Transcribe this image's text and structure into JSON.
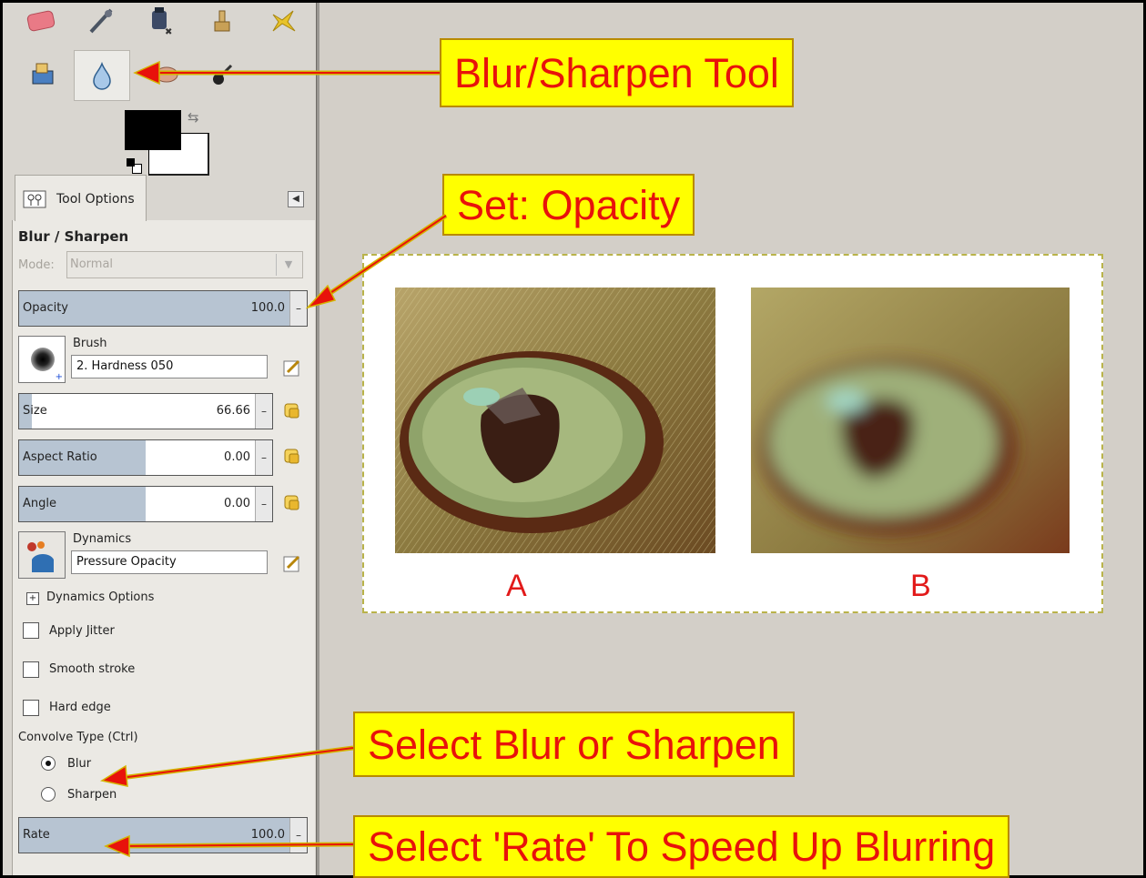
{
  "tool_options": {
    "tab_label": "Tool Options",
    "title": "Blur / Sharpen",
    "mode": {
      "label": "Mode:",
      "value": "Normal"
    },
    "opacity": {
      "label": "Opacity",
      "value": "100.0",
      "fill": 1.0
    },
    "brush": {
      "label": "Brush",
      "value": "2. Hardness 050"
    },
    "size": {
      "label": "Size",
      "value": "66.66",
      "fill": 0.05
    },
    "aspect_ratio": {
      "label": "Aspect Ratio",
      "value": "0.00",
      "fill": 0.5
    },
    "angle": {
      "label": "Angle",
      "value": "0.00",
      "fill": 0.5
    },
    "dynamics": {
      "label": "Dynamics",
      "value": "Pressure Opacity"
    },
    "dynamics_options": "Dynamics Options",
    "apply_jitter": "Apply Jitter",
    "smooth_stroke": "Smooth stroke",
    "hard_edge": "Hard edge",
    "convolve_type": {
      "label": "Convolve Type  (Ctrl)",
      "blur": "Blur",
      "sharpen": "Sharpen",
      "selected": "Blur"
    },
    "rate": {
      "label": "Rate",
      "value": "100.0",
      "fill": 1.0
    }
  },
  "callouts": {
    "tool": "Blur/Sharpen Tool",
    "opacity": "Set: Opacity",
    "convolve": "Select Blur or Sharpen",
    "rate": "Select 'Rate' To Speed Up Blurring"
  },
  "captions": {
    "a": "A",
    "b": "B"
  },
  "colors": {
    "callout_bg": "#ffff00",
    "callout_text": "#e8120b",
    "slider_fill": "#b7c4d2",
    "caption": "#e21a1a"
  }
}
